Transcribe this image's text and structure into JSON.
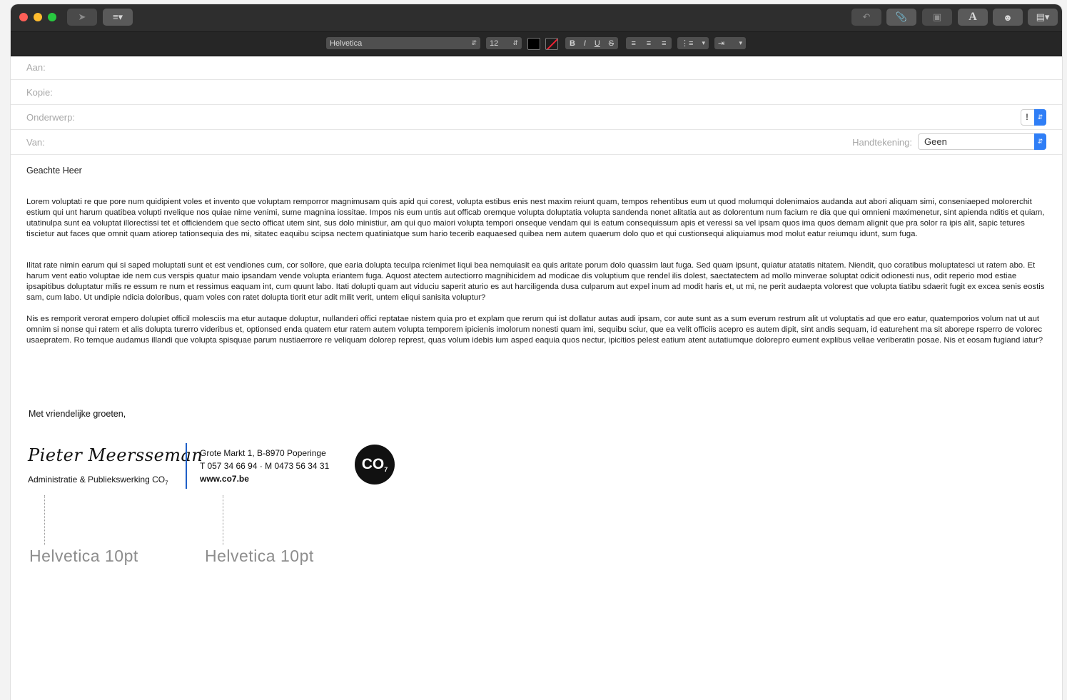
{
  "toolbar": {
    "font_name": "Helvetica",
    "font_size": "12",
    "text_color": "#000000",
    "right_buttons": [
      "reply-icon",
      "attach-icon",
      "photo-icon",
      "fonts-icon",
      "emoji-icon",
      "media-icon"
    ]
  },
  "header": {
    "to_label": "Aan:",
    "cc_label": "Kopie:",
    "subject_label": "Onderwerp:",
    "from_label": "Van:",
    "signature_label": "Handtekening:",
    "signature_value": "Geen",
    "priority_symbol": "!"
  },
  "body": {
    "greeting": "Geachte Heer",
    "paragraphs": [
      "Lorem voluptati re que pore num quidipient voles et invento que voluptam remporror magnimusam quis apid qui corest, volupta estibus enis nest maxim reiunt quam, tempos rehentibus eum ut quod molumqui dolenimaios audanda aut abori aliquam simi, conseniaeped molorerchit estium qui unt harum quatibea volupti nvelique nos quiae nime venimi, sume magnina iossitae. Impos nis eum untis aut officab oremque volupta doluptatia volupta sandenda nonet alitatia aut as dolorentum num facium re dia que qui omnieni maximenetur, sint apienda nditis et quiam, utatinulpa sunt ea voluptat illorectissi tet et officiendem que secto officat utem sint, sus dolo ministiur, am qui quo maiori volupta tempori onseque vendam qui is eatum consequissum apis et veressi sa vel ipsam quos ima quos demam alignit que pra solor ra ipis alit, sapic tetures tiscietur aut faces que omnit quam atiorep tationsequia des mi, sitatec eaquibu scipsa nectem quatiniatque sum hario tecerib eaquaesed quibea nem autem quaerum dolo quo et qui custionsequi aliquiamus mod molut eatur reiumqu idunt, sum fuga.",
      "Ilitat rate nimin earum qui si saped moluptati sunt et est vendiones cum, cor sollore, que earia dolupta teculpa rcienimet liqui bea nemquiasit ea quis aritate porum dolo quassim laut fuga. Sed quam ipsunt, quiatur atatatis nitatem. Niendit, quo coratibus moluptatesci ut ratem abo. Et harum vent eatio voluptae ide nem cus verspis quatur maio ipsandam vende volupta eriantem fuga. Aquost atectem autectiorro magnihicidem ad modicae dis voluptium que rendel ilis dolest, saectatectem ad mollo minverae soluptat odicit odionesti nus, odit reperio mod estiae ipsapitibus doluptatur milis re essum re num et ressimus eaquam int, cum quunt labo. Itati dolupti quam aut viduciu saperit aturio es aut harciligenda dusa culparum aut expel inum ad modit haris et, ut mi, ne perit audaepta volorest que volupta tiatibu sdaerit fugit ex excea senis eostis sam, cum labo. Ut undipie ndicia doloribus, quam voles con ratet dolupta tiorit etur adit milit verit, untem eliqui sanisita voluptur?",
      "Nis es remporit verorat empero dolupiet officil molesciis ma etur autaque doluptur, nullanderi offici reptatae nistem quia pro et explam que rerum qui ist dollatur autas audi ipsam, cor aute sunt as a sum everum restrum alit ut voluptatis ad que ero eatur, quatemporios volum nat ut aut omnim si nonse qui ratem et alis dolupta turerro videribus et, optionsed enda quatem etur ratem autem volupta temporem ipicienis imolorum nonesti quam imi, sequibu sciur, que ea velit officiis acepro es autem dipit, sint andis sequam, id eaturehent ma sit aborepe rsperro de volorec usaepratem. Ro temque audamus illandi que volupta spisquae parum nustiaerrore re veliquam dolorep represt, quas volum idebis ium asped eaquia quos nectur, ipicitios pelest eatium atent autatiumque dolorepro eument explibus veliae veriberatin posae. Nis et eosam fugiand iatur?"
    ],
    "closing": "Met vriendelijke groeten,"
  },
  "signature": {
    "name": "Pieter Meersseman",
    "role": "Administratie & Publiekswerking CO",
    "role_sub": "7",
    "address": "Grote Markt 1, B-8970 Poperinge",
    "phone": "T 057 34 66 94 · M 0473 56 34 31",
    "website": "www.co7.be",
    "logo_text": "CO",
    "logo_sub": "7"
  },
  "annotations": [
    "Helvetica 10pt",
    "Helvetica 10pt"
  ]
}
